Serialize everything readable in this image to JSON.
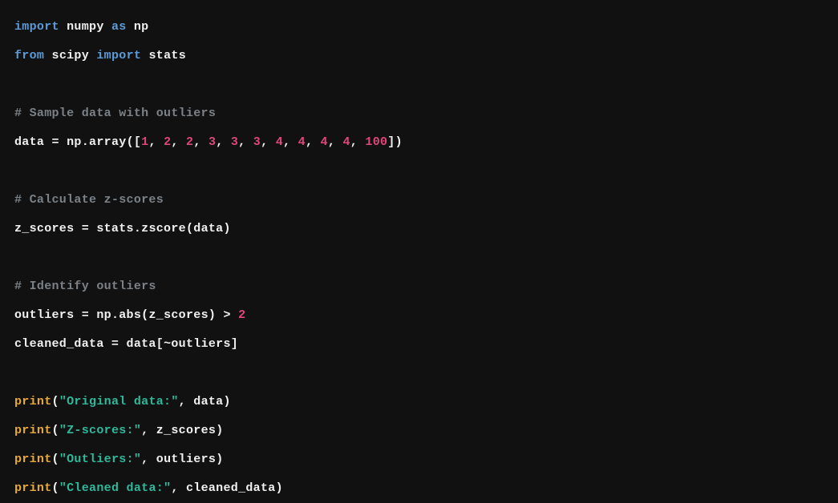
{
  "code": {
    "l1": {
      "kw1": "import",
      "mod1": "numpy",
      "kw2": "as",
      "alias1": "np"
    },
    "l2": {
      "kw1": "from",
      "mod1": "scipy",
      "kw2": "import",
      "mod2": "stats"
    },
    "l3": {
      "comment": "# Sample data with outliers"
    },
    "l4": {
      "var": "data",
      "eq": " = ",
      "np": "np",
      "dot1": ".",
      "fn": "array",
      "open": "([",
      "n1": "1",
      "c1": ", ",
      "n2": "2",
      "c2": ", ",
      "n3": "2",
      "c3": ", ",
      "n4": "3",
      "c4": ", ",
      "n5": "3",
      "c5": ", ",
      "n6": "3",
      "c6": ", ",
      "n7": "4",
      "c7": ", ",
      "n8": "4",
      "c8": ", ",
      "n9": "4",
      "c9": ", ",
      "n10": "4",
      "c10": ", ",
      "n11": "100",
      "close": "])"
    },
    "l5": {
      "comment": "# Calculate z-scores"
    },
    "l6": {
      "var": "z_scores",
      "eq": " = ",
      "obj": "stats",
      "dot": ".",
      "fn": "zscore",
      "open": "(",
      "arg": "data",
      "close": ")"
    },
    "l7": {
      "comment": "# Identify outliers"
    },
    "l8": {
      "var": "outliers",
      "eq": " = ",
      "np": "np",
      "dot": ".",
      "fn": "abs",
      "open": "(",
      "arg": "z_scores",
      "close": ")",
      "op": " > ",
      "num": "2"
    },
    "l9": {
      "var": "cleaned_data",
      "eq": " = ",
      "data": "data",
      "open": "[",
      "tilde": "~",
      "arg": "outliers",
      "close": "]"
    },
    "l10": {
      "fn": "print",
      "open": "(",
      "str": "\"Original data:\"",
      "comma": ", ",
      "arg": "data",
      "close": ")"
    },
    "l11": {
      "fn": "print",
      "open": "(",
      "str": "\"Z-scores:\"",
      "comma": ", ",
      "arg": "z_scores",
      "close": ")"
    },
    "l12": {
      "fn": "print",
      "open": "(",
      "str": "\"Outliers:\"",
      "comma": ", ",
      "arg": "outliers",
      "close": ")"
    },
    "l13": {
      "fn": "print",
      "open": "(",
      "str": "\"Cleaned data:\"",
      "comma": ", ",
      "arg": "cleaned_data",
      "close": ")"
    }
  }
}
